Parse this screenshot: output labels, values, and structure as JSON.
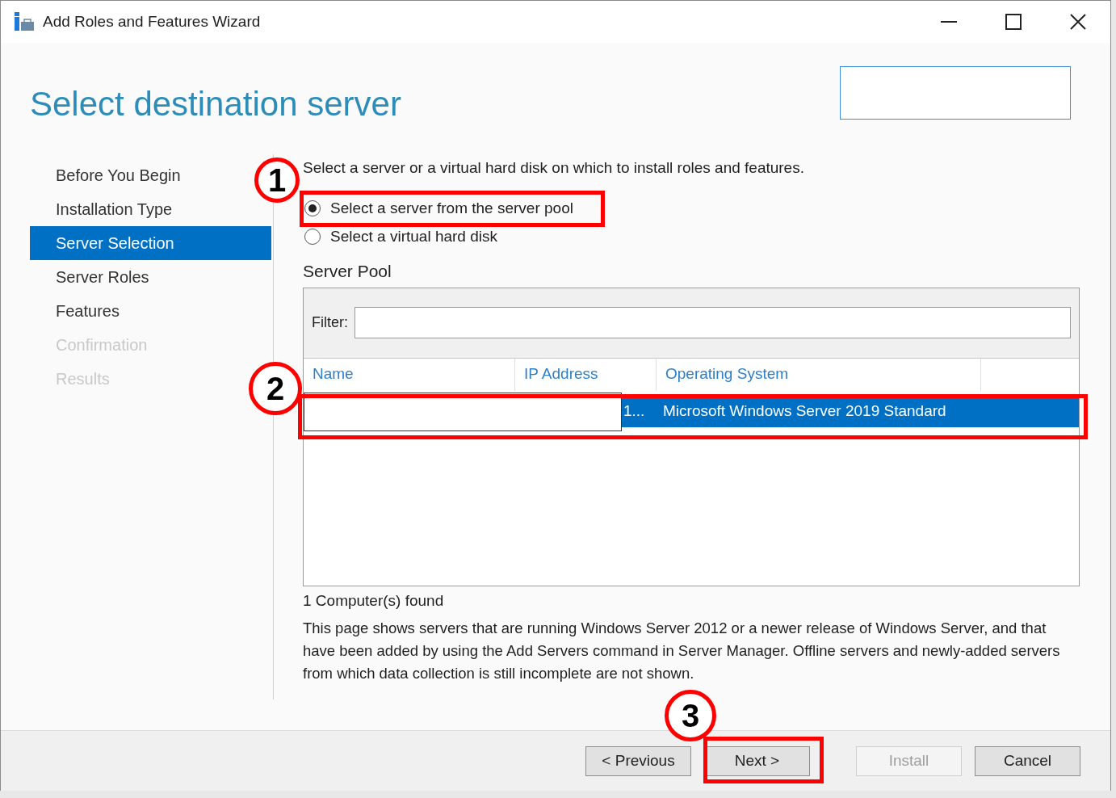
{
  "window": {
    "title": "Add Roles and Features Wizard"
  },
  "page_title": "Select destination server",
  "steps": [
    {
      "label": "Before You Begin",
      "selected": false,
      "disabled": false
    },
    {
      "label": "Installation Type",
      "selected": false,
      "disabled": false
    },
    {
      "label": "Server Selection",
      "selected": true,
      "disabled": false
    },
    {
      "label": "Server Roles",
      "selected": false,
      "disabled": false
    },
    {
      "label": "Features",
      "selected": false,
      "disabled": false
    },
    {
      "label": "Confirmation",
      "selected": false,
      "disabled": true
    },
    {
      "label": "Results",
      "selected": false,
      "disabled": true
    }
  ],
  "instruction": "Select a server or a virtual hard disk on which to install roles and features.",
  "options": [
    {
      "label": "Select a server from the server pool",
      "selected": true
    },
    {
      "label": "Select a virtual hard disk",
      "selected": false
    }
  ],
  "server_pool": {
    "heading": "Server Pool",
    "filter_label": "Filter:",
    "columns": [
      "Name",
      "IP Address",
      "Operating System"
    ],
    "rows": [
      {
        "ip_address": "1...",
        "operating_system": "Microsoft Windows Server 2019 Standard",
        "selected": true
      }
    ]
  },
  "found": "1 Computer(s) found",
  "description": "This page shows servers that are running Windows Server 2012 or a newer release of Windows Server, and that have been added by using the Add Servers command in Server Manager. Offline servers and newly-added servers from which data collection is still incomplete are not shown.",
  "buttons": [
    {
      "label": "< Previous",
      "disabled": false
    },
    {
      "label": "Next >",
      "disabled": false
    },
    {
      "label": "Install",
      "disabled": true
    },
    {
      "label": "Cancel",
      "disabled": false
    }
  ],
  "callouts": [
    "1",
    "2",
    "3"
  ]
}
